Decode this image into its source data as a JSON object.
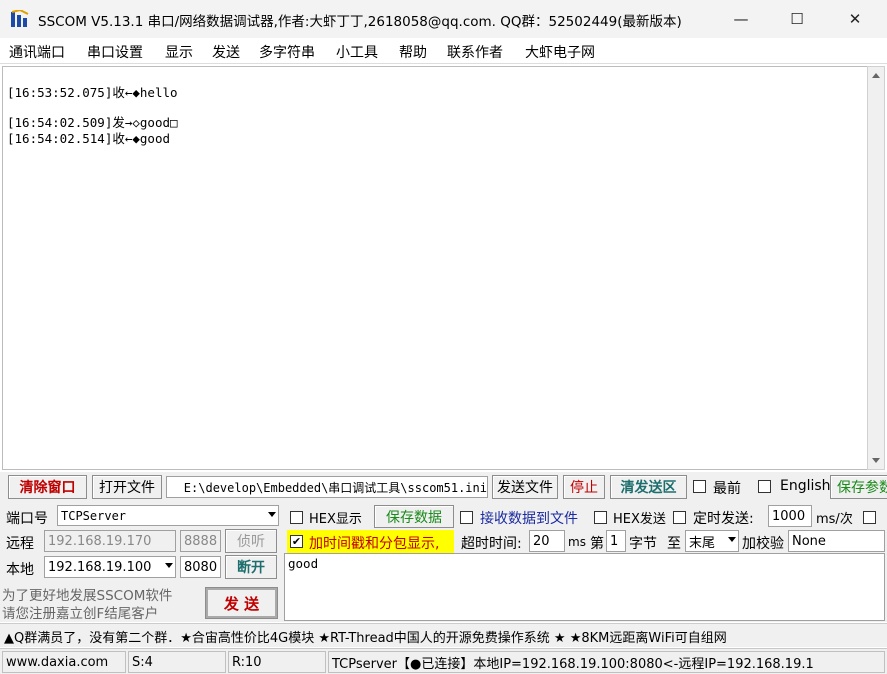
{
  "window": {
    "title": "SSCOM V5.13.1 串口/网络数据调试器,作者:大虾丁丁,2618058@qq.com. QQ群：52502449(最新版本)",
    "minimize": "—",
    "maximize": "☐",
    "close": "✕"
  },
  "menu": [
    "通讯端口",
    "串口设置",
    "显示",
    "发送",
    "多字符串",
    "小工具",
    "帮助",
    "联系作者",
    "大虾电子网"
  ],
  "log": [
    "[16:53:52.075]收←◆hello",
    "[16:54:02.509]发→◇good□",
    "[16:54:02.514]收←◆good"
  ],
  "toolbar": {
    "clear_window": "清除窗口",
    "open_file": "打开文件",
    "file_path": "E:\\develop\\Embedded\\串口调试工具\\sscom51.ini",
    "send_file": "发送文件",
    "stop": "停止",
    "clear_send": "清发送区",
    "latest": "最前",
    "english": "English",
    "save_params": "保存参数"
  },
  "port": {
    "port_label": "端口号",
    "port_value": "TCPServer",
    "remote_label": "远程",
    "remote_ip": "192.168.19.170",
    "remote_port": "8888",
    "listen": "侦听",
    "local_label": "本地",
    "local_ip": "192.168.19.100",
    "local_port": "8080",
    "disconnect": "断开"
  },
  "options": {
    "hex_display": "HEX显示",
    "save_data": "保存数据",
    "recv_to_file": "接收数据到文件",
    "hex_send": "HEX发送",
    "timed_send": "定时发送:",
    "interval": "1000",
    "interval_unit": "ms/次",
    "timestamp": "加时间戳和分包显示,",
    "timeout_label": "超时时间:",
    "timeout": "20",
    "timeout_unit": "ms",
    "nth_label": "第",
    "nth": "1",
    "byte_label": "字节",
    "to_label": "至",
    "end_value": "末尾",
    "checksum_label": "加校验",
    "checksum": "None"
  },
  "promo": {
    "line1": "为了更好地发展SSCOM软件",
    "line2": "请您注册嘉立创F结尾客户"
  },
  "send": {
    "button": "发  送",
    "text": "good"
  },
  "ticker": "▲Q群满员了，没有第二个群．★合宙高性价比4G模块 ★RT-Thread中国人的开源免费操作系统 ★ ★8KM远距离WiFi可自组网",
  "status": {
    "site": "www.daxia.com",
    "sent": "S:4",
    "received": "R:10",
    "connection": "TCPserver【●已连接】本地IP=192.168.19.100:8080<-远程IP=192.168.19.1"
  }
}
